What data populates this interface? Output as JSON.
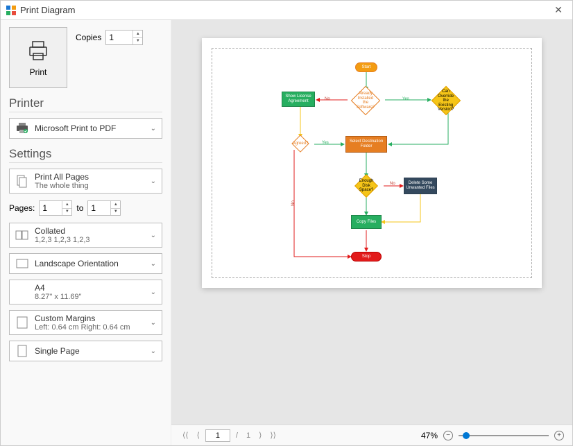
{
  "window": {
    "title": "Print Diagram"
  },
  "print": {
    "print_label": "Print",
    "copies_label": "Copies",
    "copies_value": "1"
  },
  "printer": {
    "section": "Printer",
    "name": "Microsoft Print to PDF"
  },
  "settings": {
    "section": "Settings",
    "scope": {
      "title": "Print All Pages",
      "sub": "The whole thing"
    },
    "pages_label": "Pages:",
    "pages_from": "1",
    "pages_to_label": "to",
    "pages_to": "1",
    "collate": {
      "title": "Collated",
      "sub": "1,2,3   1,2,3   1,2,3"
    },
    "orientation": "Landscape Orientation",
    "paper": {
      "title": "A4",
      "sub": "8.27\" x 11.69\""
    },
    "margins": {
      "title": "Custom Margins",
      "sub": "Left: 0.64 cm  Right: 0.64 cm"
    },
    "pageset": "Single Page"
  },
  "flowchart": {
    "start": "Start",
    "show_license": "Show License Agreement",
    "already_installed": "Already Installed the Software?",
    "can_override": "Can Override the Existing Version?",
    "agreed": "Agreed?",
    "select_dest": "Select Destination Folder",
    "enough_space": "Enough Disk Space?",
    "delete_files": "Delete Some Unwanted Files",
    "copy_files": "Copy Files",
    "stop": "Stop",
    "yes": "Yes",
    "no": "No"
  },
  "status": {
    "page_current": "1",
    "page_sep": "/",
    "page_total": "1",
    "zoom": "47%"
  }
}
